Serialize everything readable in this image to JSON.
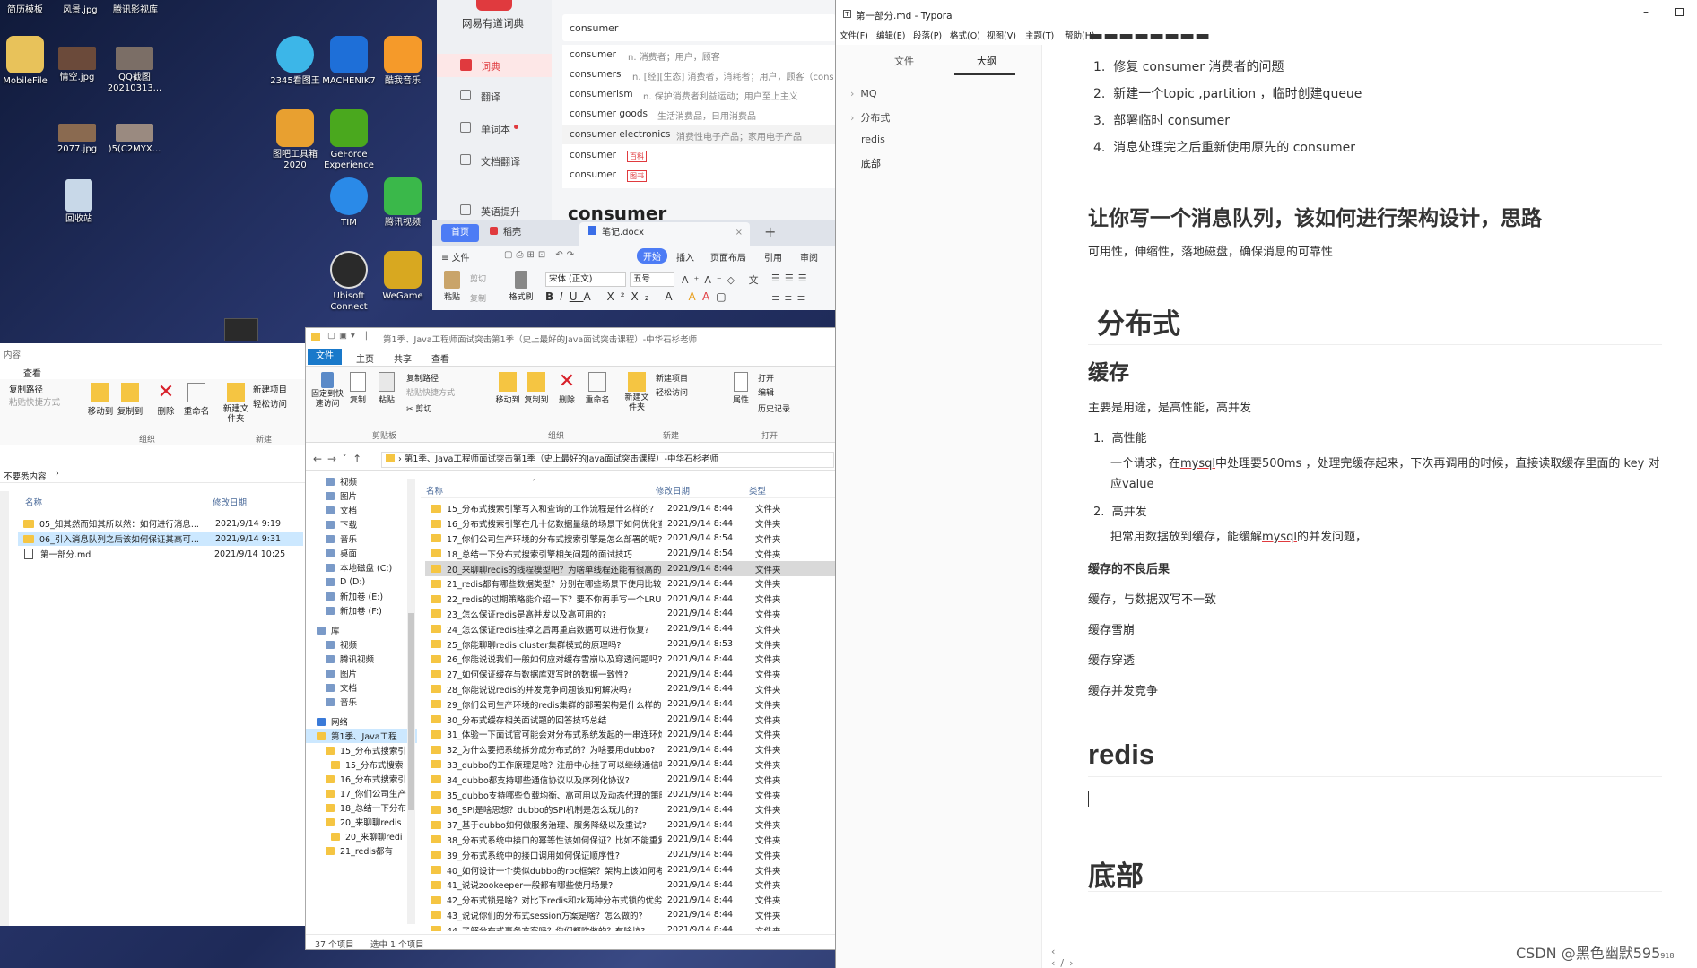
{
  "desktop": {
    "top_labels": [
      "简历模板",
      "风景.jpg",
      "腾讯影视库"
    ],
    "icons": [
      {
        "label": "MobileFile",
        "color": "#e8c25a"
      },
      {
        "label": "情空.jpg",
        "color": "#6b4a3a"
      },
      {
        "label": "QQ截图20210313...",
        "color": "#7b6e66"
      },
      {
        "label": "2077.jpg",
        "color": "#8a6a50"
      },
      {
        "label": ")5(C2MYX...",
        "color": "#9a8a80"
      },
      {
        "label": "回收站",
        "color": "#c8d8e8"
      },
      {
        "label": "2345看图王",
        "color": "#3cb6e8"
      },
      {
        "label": "MACHENIK7",
        "color": "#1e6fd8"
      },
      {
        "label": "酷我音乐",
        "color": "#f59a2a"
      },
      {
        "label": "图吧工具箱2020",
        "color": "#e8a030"
      },
      {
        "label": "GeForce Experience",
        "color": "#4aa81e"
      },
      {
        "label": "TIM",
        "color": "#2a8ae8"
      },
      {
        "label": "腾讯视频",
        "color": "#3ab84a"
      },
      {
        "label": "Ubisoft Connect",
        "color": "#2a2a2a"
      },
      {
        "label": "WeGame",
        "color": "#d8a820"
      }
    ]
  },
  "youdao": {
    "brand": "网易有道词典",
    "nav": [
      "词典",
      "翻译",
      "单词本",
      "文档翻译",
      "英语提升"
    ],
    "search_value": "consumer",
    "suggestions": [
      {
        "word": "consumer",
        "def": "n. 消费者；用户，顾客"
      },
      {
        "word": "consumers",
        "def": "n. [经][生态] 消费者，消耗者；用户，顾客（cons"
      },
      {
        "word": "consumerism",
        "def": "n. 保护消费者利益运动；用户至上主义"
      },
      {
        "word": "consumer goods",
        "def": "生活消费品，日用消费品"
      },
      {
        "word": "consumer electronics",
        "def": "消费性电子产品；家用电子产品"
      },
      {
        "word": "consumer",
        "def": "百科"
      },
      {
        "word": "consumer",
        "def": "图书"
      }
    ],
    "heading": "consumer"
  },
  "wps": {
    "tabs": [
      "首页",
      "稻壳",
      "笔记.docx"
    ],
    "menu": [
      "文件",
      "开始",
      "插入",
      "页面布局",
      "引用",
      "审阅"
    ],
    "font_name": "宋体 (正文)",
    "font_size": "五号",
    "paste": "粘贴",
    "cut": "剪切",
    "copy": "复制",
    "format_painter": "格式刷"
  },
  "explorer_left": {
    "ribbon": [
      "复制路径",
      "粘贴快捷方式",
      "移动到",
      "复制到",
      "删除",
      "重命名",
      "新建文件夹",
      "新建项目",
      "轻松访问"
    ],
    "groups": [
      "组织",
      "新建"
    ],
    "tabs_partial": [
      "内容",
      "查看"
    ],
    "path": "不要悉内容",
    "col_name": "名称",
    "col_date": "修改日期",
    "files": [
      {
        "name": "05_知其然而知其所以然：如何进行消息...",
        "date": "2021/9/14 9:19",
        "type": "folder"
      },
      {
        "name": "06_引入消息队列之后该如何保证其高可...",
        "date": "2021/9/14 9:31",
        "type": "folder"
      },
      {
        "name": "第一部分.md",
        "date": "2021/9/14 10:25",
        "type": "file"
      }
    ]
  },
  "explorer_main": {
    "title": "第1季、Java工程师面试突击第1季（史上最好的Java面试突击课程）-中华石杉老师",
    "tabs": [
      "文件",
      "主页",
      "共享",
      "查看"
    ],
    "ribbon_clip": [
      "固定到快速访问",
      "复制",
      "粘贴",
      "复制路径",
      "粘贴快捷方式",
      "剪切"
    ],
    "ribbon_org": [
      "移动到",
      "复制到",
      "删除",
      "重命名"
    ],
    "ribbon_new": [
      "新建文件夹",
      "新建项目",
      "轻松访问"
    ],
    "ribbon_open": [
      "属性",
      "打开",
      "编辑",
      "历史记录"
    ],
    "groups": [
      "剪贴板",
      "组织",
      "新建",
      "打开"
    ],
    "address": "第1季、Java工程师面试突击第1季（史上最好的Java面试突击课程）-中华石杉老师",
    "nav_tree": [
      "视频",
      "图片",
      "文档",
      "下载",
      "音乐",
      "桌面",
      "本地磁盘 (C:)",
      "D (D:)",
      "新加卷 (E:)",
      "新加卷 (F:)",
      "库",
      "视频",
      "腾讯视频",
      "图片",
      "文档",
      "音乐",
      "网络",
      "第1季、Java工程",
      "15_分布式搜索引",
      "15_分布式搜索",
      "16_分布式搜索引",
      "17_你们公司生产",
      "18_总结一下分布",
      "20_来聊聊redis",
      "20_来聊聊redi",
      "21_redis都有"
    ],
    "col_name": "名称",
    "col_date": "修改日期",
    "col_type": "类型",
    "files": [
      {
        "name": "15_分布式搜索引擎写入和查询的工作流程是什么样的?",
        "date": "2021/9/14 8:44"
      },
      {
        "name": "16_分布式搜索引擎在几十亿数据量级的场景下如何优化查询性...",
        "date": "2021/9/14 8:44"
      },
      {
        "name": "17_你们公司生产环境的分布式搜索引擎是怎么部署的呢?",
        "date": "2021/9/14 8:54"
      },
      {
        "name": "18_总结一下分布式搜索引擎相关问题的面试技巧",
        "date": "2021/9/14 8:54"
      },
      {
        "name": "20_来聊聊redis的线程模型吧？为啥单线程还能有很高的效率?",
        "date": "2021/9/14 8:44"
      },
      {
        "name": "21_redis都有哪些数据类型？分别在哪些场景下使用比较合适呢?",
        "date": "2021/9/14 8:44"
      },
      {
        "name": "22_redis的过期策略能介绍一下？要不你再手写一个LRU?",
        "date": "2021/9/14 8:44"
      },
      {
        "name": "23_怎么保证redis是高并发以及高可用的?",
        "date": "2021/9/14 8:44"
      },
      {
        "name": "24_怎么保证redis挂掉之后再重启数据可以进行恢复?",
        "date": "2021/9/14 8:44"
      },
      {
        "name": "25_你能聊聊redis cluster集群模式的原理吗?",
        "date": "2021/9/14 8:53"
      },
      {
        "name": "26_你能说说我们一般如何应对缓存雪崩以及穿透问题吗?",
        "date": "2021/9/14 8:44"
      },
      {
        "name": "27_如何保证缓存与数据库双写时的数据一致性?",
        "date": "2021/9/14 8:44"
      },
      {
        "name": "28_你能说说redis的并发竞争问题该如何解决吗?",
        "date": "2021/9/14 8:44"
      },
      {
        "name": "29_你们公司生产环境的redis集群的部署架构是什么样的?",
        "date": "2021/9/14 8:44"
      },
      {
        "name": "30_分布式缓存相关面试题的回答技巧总结",
        "date": "2021/9/14 8:44"
      },
      {
        "name": "31_体验一下面试官可能会对分布式系统发起的一串连环炮",
        "date": "2021/9/14 8:44"
      },
      {
        "name": "32_为什么要把系统拆分成分布式的？为啥要用dubbo?",
        "date": "2021/9/14 8:44"
      },
      {
        "name": "33_dubbo的工作原理是啥？注册中心挂了可以继续通信吗?",
        "date": "2021/9/14 8:44"
      },
      {
        "name": "34_dubbo都支持哪些通信协议以及序列化协议?",
        "date": "2021/9/14 8:44"
      },
      {
        "name": "35_dubbo支持哪些负载均衡、高可用以及动态代理的策略?",
        "date": "2021/9/14 8:44"
      },
      {
        "name": "36_SPI是啥思想？dubbo的SPI机制是怎么玩儿的?",
        "date": "2021/9/14 8:44"
      },
      {
        "name": "37_基于dubbo如何做服务治理、服务降级以及重试?",
        "date": "2021/9/14 8:44"
      },
      {
        "name": "38_分布式系统中接口的幂等性该如何保证？比如不能重复扣款?",
        "date": "2021/9/14 8:44"
      },
      {
        "name": "39_分布式系统中的接口调用如何保证顺序性?",
        "date": "2021/9/14 8:44"
      },
      {
        "name": "40_如何设计一个类似dubbo的rpc框架？架构上该如何考虑?",
        "date": "2021/9/14 8:44"
      },
      {
        "name": "41_说说zookeeper一般都有哪些使用场景?",
        "date": "2021/9/14 8:44"
      },
      {
        "name": "42_分布式锁是啥？对比下redis和zk两种分布式锁的优劣?",
        "date": "2021/9/14 8:44"
      },
      {
        "name": "43_说说你们的分布式session方案是啥？怎么做的?",
        "date": "2021/9/14 8:44"
      },
      {
        "name": "44_了解分布式事务方案吗？你们都咋做的？有啥坑?",
        "date": "2021/9/14 8:44"
      }
    ],
    "type_label": "文件夹",
    "status_count": "37 个项目",
    "status_selected": "选中 1 个项目"
  },
  "typora": {
    "title": "第一部分.md - Typora",
    "menu": [
      "文件(F)",
      "编辑(E)",
      "段落(P)",
      "格式(O)",
      "视图(V)",
      "主题(T)",
      "帮助(H)"
    ],
    "side_tabs": [
      "文件",
      "大纲"
    ],
    "outline": [
      "MQ",
      "分布式",
      "redis",
      "底部"
    ],
    "list1": [
      "修复 consumer 消费者的问题",
      "新建一个topic ,partition ，临时创建queue",
      "部署临时 consumer",
      "消息处理完之后重新使用原先的 consumer"
    ],
    "h2_queue": "让你写一个消息队列，该如何进行架构设计，思路",
    "p_queue": "可用性，伸缩性，落地磁盘，确保消息的可靠性",
    "h1_dist": "分布式",
    "h2_cache": "缓存",
    "p_cache": "主要是用途，是高性能，高并发",
    "li_perf": "高性能",
    "p_perf_a": "一个请求，在",
    "p_perf_link": "mysql",
    "p_perf_b": "中处理要500ms ，处理完缓存起来，下次再调用的时候，直接读取缓存里面的 key 对应value",
    "li_conc": "高并发",
    "p_conc_a": "把常用数据放到缓存，能缓解",
    "p_conc_link": "mysql",
    "p_conc_b": "的并发问题，",
    "h4_bad": "缓存的不良后果",
    "bad_list": [
      "缓存，与数据双写不一致",
      "缓存雪崩",
      "缓存穿透",
      "缓存并发竞争"
    ],
    "h1_redis": "redis",
    "h1_bottom": "底部",
    "watermark": "CSDN @黑色幽默595",
    "watermark_tail": "918"
  }
}
